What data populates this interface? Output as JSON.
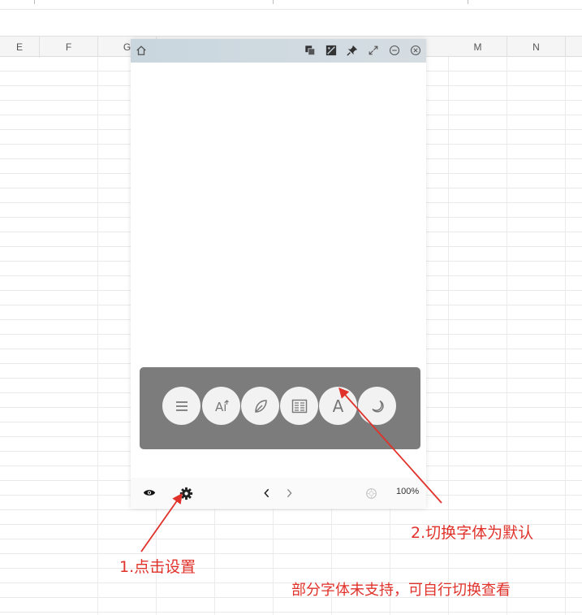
{
  "spreadsheet": {
    "columns": [
      "E",
      "F",
      "G",
      "M",
      "N"
    ]
  },
  "reader": {
    "titlebar_icons": [
      "home-icon",
      "copy-icon",
      "image-icon",
      "pin-icon",
      "expand-icon",
      "minimize-icon",
      "close-icon"
    ],
    "toolbar_buttons": [
      {
        "icon": "menu-icon"
      },
      {
        "icon": "font-size-icon",
        "text": "Ai"
      },
      {
        "icon": "leaf-icon"
      },
      {
        "icon": "layout-icon"
      },
      {
        "icon": "font-icon",
        "text": "A"
      },
      {
        "icon": "moon-icon"
      }
    ],
    "footer": {
      "zoom": "100%"
    }
  },
  "annotations": {
    "step1": "1.点击设置",
    "step2": "2.切换字体为默认",
    "note": "部分字体未支持，可自行切换查看"
  },
  "colors": {
    "annotation": "#e0322a",
    "overlay": "#7c7c7c",
    "titlebar": "#c9d6de"
  }
}
